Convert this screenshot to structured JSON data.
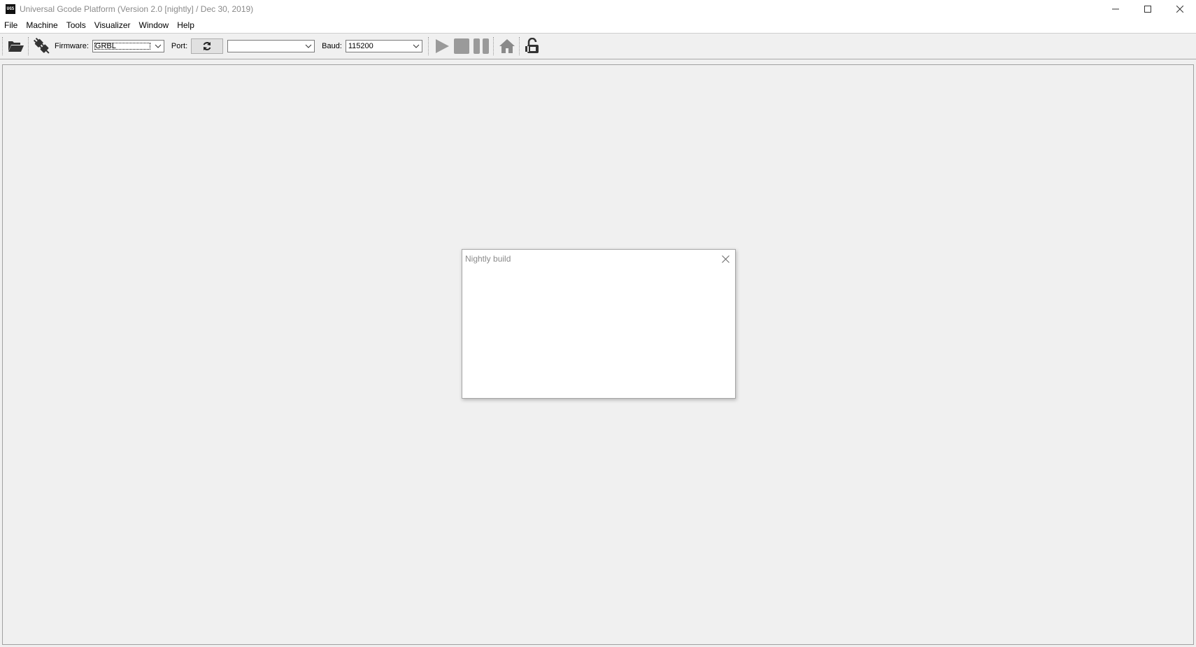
{
  "window": {
    "title": "Universal Gcode Platform (Version 2.0 [nightly]  / Dec 30, 2019)",
    "app_icon_text": "UGS"
  },
  "menu": {
    "items": [
      "File",
      "Machine",
      "Tools",
      "Visualizer",
      "Window",
      "Help"
    ]
  },
  "toolbar": {
    "firmware_label": "Firmware:",
    "firmware_value": "GRBL",
    "port_label": "Port:",
    "port_value": "",
    "baud_label": "Baud:",
    "baud_value": "115200",
    "icons": [
      "folder-open-icon",
      "connect-plug-icon",
      "refresh-icon",
      "play-icon",
      "stop-icon",
      "pause-icon",
      "home-icon",
      "unlock-icon"
    ]
  },
  "dialog": {
    "title": "Nightly build"
  },
  "colors": {
    "title_text": "#8a8a8a",
    "disabled_icon": "#9a9a9a",
    "dark_icon": "#333333",
    "background": "#f0f0f0"
  }
}
